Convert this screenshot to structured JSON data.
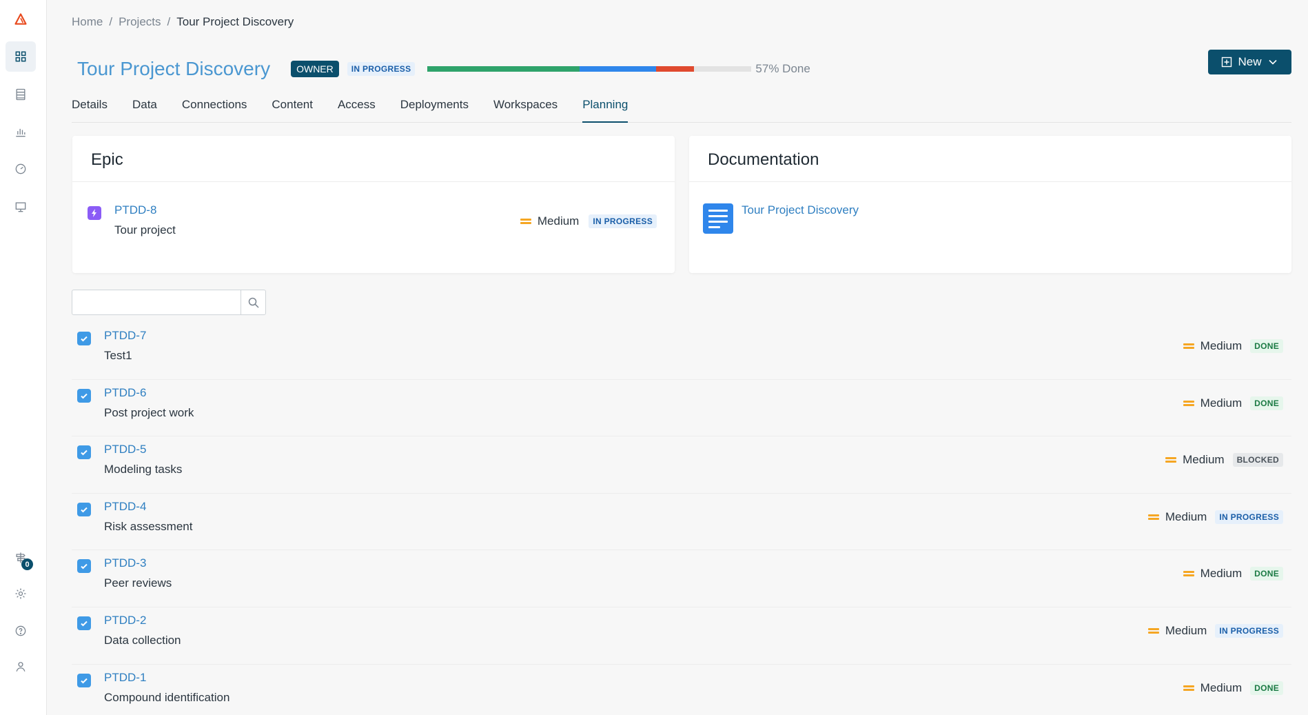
{
  "breadcrumb": {
    "home": "Home",
    "projects": "Projects",
    "current": "Tour Project Discovery",
    "separator": "/"
  },
  "project": {
    "title": "Tour Project Discovery",
    "role_badge": "OWNER",
    "status": "IN PROGRESS",
    "progress": {
      "label": "57% Done",
      "done_fraction": 0.47,
      "in_progress_fraction": 0.235,
      "blocked_fraction": 0.117
    },
    "colors": {
      "done": "#2fa36b",
      "in_progress": "#2f86eb",
      "blocked": "#e04a2f"
    }
  },
  "new_button": {
    "label": "New"
  },
  "tabs": [
    {
      "label": "Details"
    },
    {
      "label": "Data"
    },
    {
      "label": "Connections"
    },
    {
      "label": "Content"
    },
    {
      "label": "Access"
    },
    {
      "label": "Deployments"
    },
    {
      "label": "Workspaces"
    },
    {
      "label": "Planning",
      "active": true
    }
  ],
  "epic_card": {
    "title": "Epic",
    "key": "PTDD-8",
    "summary": "Tour project",
    "priority": "Medium",
    "status": "IN PROGRESS"
  },
  "doc_card": {
    "title": "Documentation",
    "link": "Tour Project Discovery"
  },
  "search": {
    "placeholder": "",
    "value": ""
  },
  "tasks": [
    {
      "key": "PTDD-7",
      "summary": "Test1",
      "priority": "Medium",
      "status": "DONE"
    },
    {
      "key": "PTDD-6",
      "summary": "Post project work",
      "priority": "Medium",
      "status": "DONE"
    },
    {
      "key": "PTDD-5",
      "summary": "Modeling tasks",
      "priority": "Medium",
      "status": "BLOCKED"
    },
    {
      "key": "PTDD-4",
      "summary": "Risk assessment",
      "priority": "Medium",
      "status": "IN PROGRESS"
    },
    {
      "key": "PTDD-3",
      "summary": "Peer reviews",
      "priority": "Medium",
      "status": "DONE"
    },
    {
      "key": "PTDD-2",
      "summary": "Data collection",
      "priority": "Medium",
      "status": "IN PROGRESS"
    },
    {
      "key": "PTDD-1",
      "summary": "Compound identification",
      "priority": "Medium",
      "status": "DONE"
    }
  ],
  "sidebar": {
    "items": [
      {
        "icon": "logo-icon"
      },
      {
        "icon": "dashboard-grid-icon"
      },
      {
        "icon": "database-icon"
      },
      {
        "icon": "bar-chart-icon"
      },
      {
        "icon": "gauge-icon"
      },
      {
        "icon": "monitor-icon"
      },
      {
        "icon": "signpost-icon",
        "badge": "0"
      },
      {
        "icon": "gear-icon"
      },
      {
        "icon": "help-icon"
      },
      {
        "icon": "user-icon"
      }
    ]
  }
}
